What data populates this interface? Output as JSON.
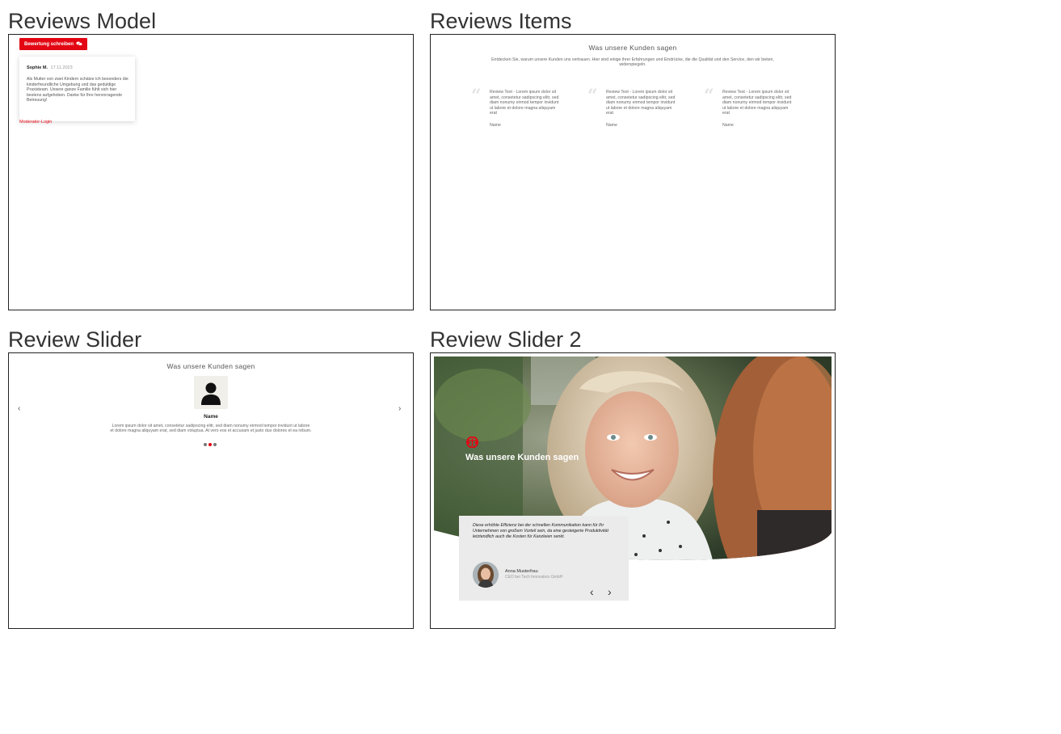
{
  "panels": {
    "reviews_model": {
      "title": "Reviews Model",
      "write_button_label": "Bewertung schreiben",
      "review": {
        "author": "Sophie M.",
        "date": "17.11.2023",
        "text": "Als Mutter von zwei Kindern schätze ich besonders die kinderfreundliche Umgebung und das geduldige Praxisteam. Unsere ganze Familie fühlt sich hier bestens aufgehoben. Danke für Ihre hervorragende Betreuung!"
      },
      "moderator_link": "Moderator-Login"
    },
    "reviews_items": {
      "title": "Reviews Items",
      "heading": "Was unsere Kunden sagen",
      "subheading": "Entdecken Sie, warum unsere Kunden uns vertrauen. Hier sind einige ihrer Erfahrungen und Eindrücke, die die Qualität und den Service, den wir bieten, widerspiegeln.",
      "items": [
        {
          "text": "Review Text - Lorem ipsum dolor sit amet, consetetur sadipscing elitr, sed diam nonumy eirmod tempor invidunt ut labore et dolore magna aliquyam erat",
          "name": "Name"
        },
        {
          "text": "Review Text - Lorem ipsum dolor sit amet, consetetur sadipscing elitr, sed diam nonumy eirmod tempor invidunt ut labore et dolore magna aliquyam erat",
          "name": "Name"
        },
        {
          "text": "Review Text - Lorem ipsum dolor sit amet, consetetur sadipscing elitr, sed diam nonumy eirmod tempor invidunt ut labore et dolore magna aliquyam erat",
          "name": "Name"
        }
      ]
    },
    "review_slider": {
      "title": "Review Slider",
      "heading": "Was unsere Kunden sagen",
      "name": "Name",
      "text": "Lorem ipsum dolor sit amet, consetetur sadipscing elitr, sed diam nonumy eirmod tempor invidunt ut labore et dolore magna aliquyam erat, sed diam voluptua. At vero eos et accusam et justo duo dolores et ea rebum.",
      "prev_arrow": "‹",
      "next_arrow": "›",
      "active_dot": 2
    },
    "review_slider_2": {
      "title": "Review Slider 2",
      "heading": "Was unsere Kunden sagen",
      "quote": "Diese erhöhte Effizienz bei der schnellen Kommunikation kann für Ihr Unternehmen von großem Vorteil sein, da eine gesteigerte Produktivität letztendlich auch die Kosten für Kanzleien senkt.",
      "person_name": "Anna Musterfrau",
      "person_role": "CEO bei Tech Innovators GmbH",
      "prev_arrow": "‹",
      "next_arrow": "›"
    }
  },
  "colors": {
    "accent": "#e30613",
    "frame_border": "#222222",
    "testimonial_bg": "#ebebeb"
  }
}
